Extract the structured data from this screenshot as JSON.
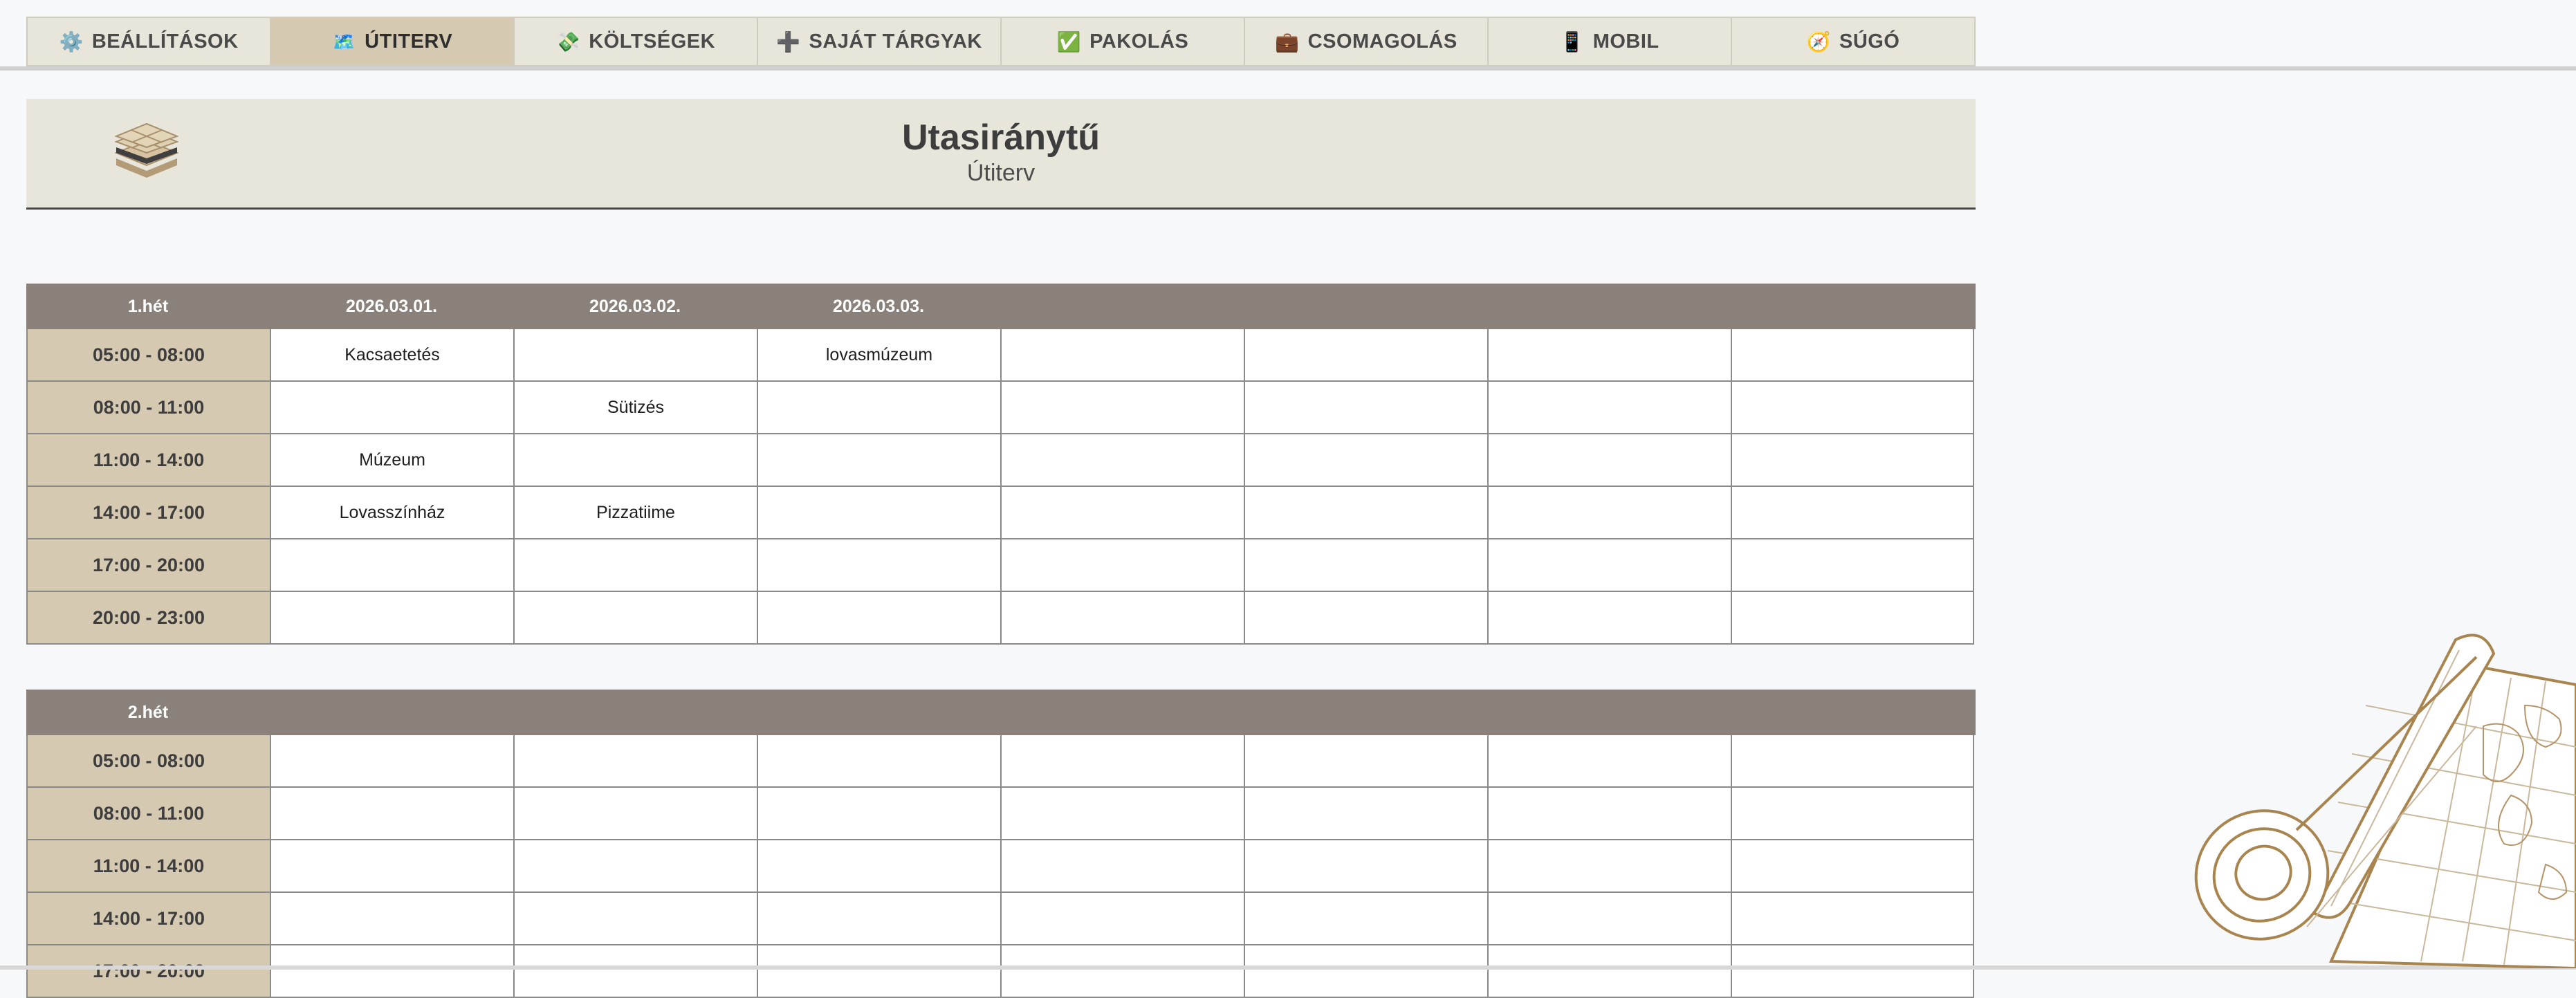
{
  "tabs": [
    {
      "icon": "⚙️",
      "label": "BEÁLLÍTÁSOK",
      "active": false
    },
    {
      "icon": "🗺️",
      "label": "ÚTITERV",
      "active": true
    },
    {
      "icon": "💸",
      "label": "KÖLTSÉGEK",
      "active": false
    },
    {
      "icon": "➕",
      "label": "SAJÁT TÁRGYAK",
      "active": false
    },
    {
      "icon": "✅",
      "label": "PAKOLÁS",
      "active": false
    },
    {
      "icon": "💼",
      "label": "CSOMAGOLÁS",
      "active": false
    },
    {
      "icon": "📱",
      "label": "MOBIL",
      "active": false
    },
    {
      "icon": "🧭",
      "label": "SÚGÓ",
      "active": false
    }
  ],
  "header": {
    "title": "Utasiránytű",
    "subtitle": "Útiterv"
  },
  "weeks": [
    {
      "label": "1.hét",
      "dates": [
        "2026.03.01.",
        "2026.03.02.",
        "2026.03.03.",
        "",
        "",
        "",
        ""
      ],
      "rows": [
        {
          "time": "05:00 - 08:00",
          "cells": [
            "Kacsaetetés",
            "",
            "lovasmúzeum",
            "",
            "",
            "",
            ""
          ]
        },
        {
          "time": "08:00 - 11:00",
          "cells": [
            "",
            "Sütizés",
            "",
            "",
            "",
            "",
            ""
          ]
        },
        {
          "time": "11:00 - 14:00",
          "cells": [
            "Múzeum",
            "",
            "",
            "",
            "",
            "",
            ""
          ]
        },
        {
          "time": "14:00 - 17:00",
          "cells": [
            "Lovasszínház",
            "Pizzatiime",
            "",
            "",
            "",
            "",
            ""
          ]
        },
        {
          "time": "17:00 - 20:00",
          "cells": [
            "",
            "",
            "",
            "",
            "",
            "",
            ""
          ]
        },
        {
          "time": "20:00 - 23:00",
          "cells": [
            "",
            "",
            "",
            "",
            "",
            "",
            ""
          ]
        }
      ]
    },
    {
      "label": "2.hét",
      "dates": [
        "",
        "",
        "",
        "",
        "",
        "",
        ""
      ],
      "rows": [
        {
          "time": "05:00 - 08:00",
          "cells": [
            "",
            "",
            "",
            "",
            "",
            "",
            ""
          ]
        },
        {
          "time": "08:00 - 11:00",
          "cells": [
            "",
            "",
            "",
            "",
            "",
            "",
            ""
          ]
        },
        {
          "time": "11:00 - 14:00",
          "cells": [
            "",
            "",
            "",
            "",
            "",
            "",
            ""
          ]
        },
        {
          "time": "14:00 - 17:00",
          "cells": [
            "",
            "",
            "",
            "",
            "",
            "",
            ""
          ]
        },
        {
          "time": "17:00 - 20:00",
          "cells": [
            "",
            "",
            "",
            "",
            "",
            "",
            ""
          ]
        }
      ]
    }
  ],
  "colors": {
    "accent": "#d5c9b1",
    "header_bg": "#e8e6db",
    "week_header": "#8a817b"
  }
}
